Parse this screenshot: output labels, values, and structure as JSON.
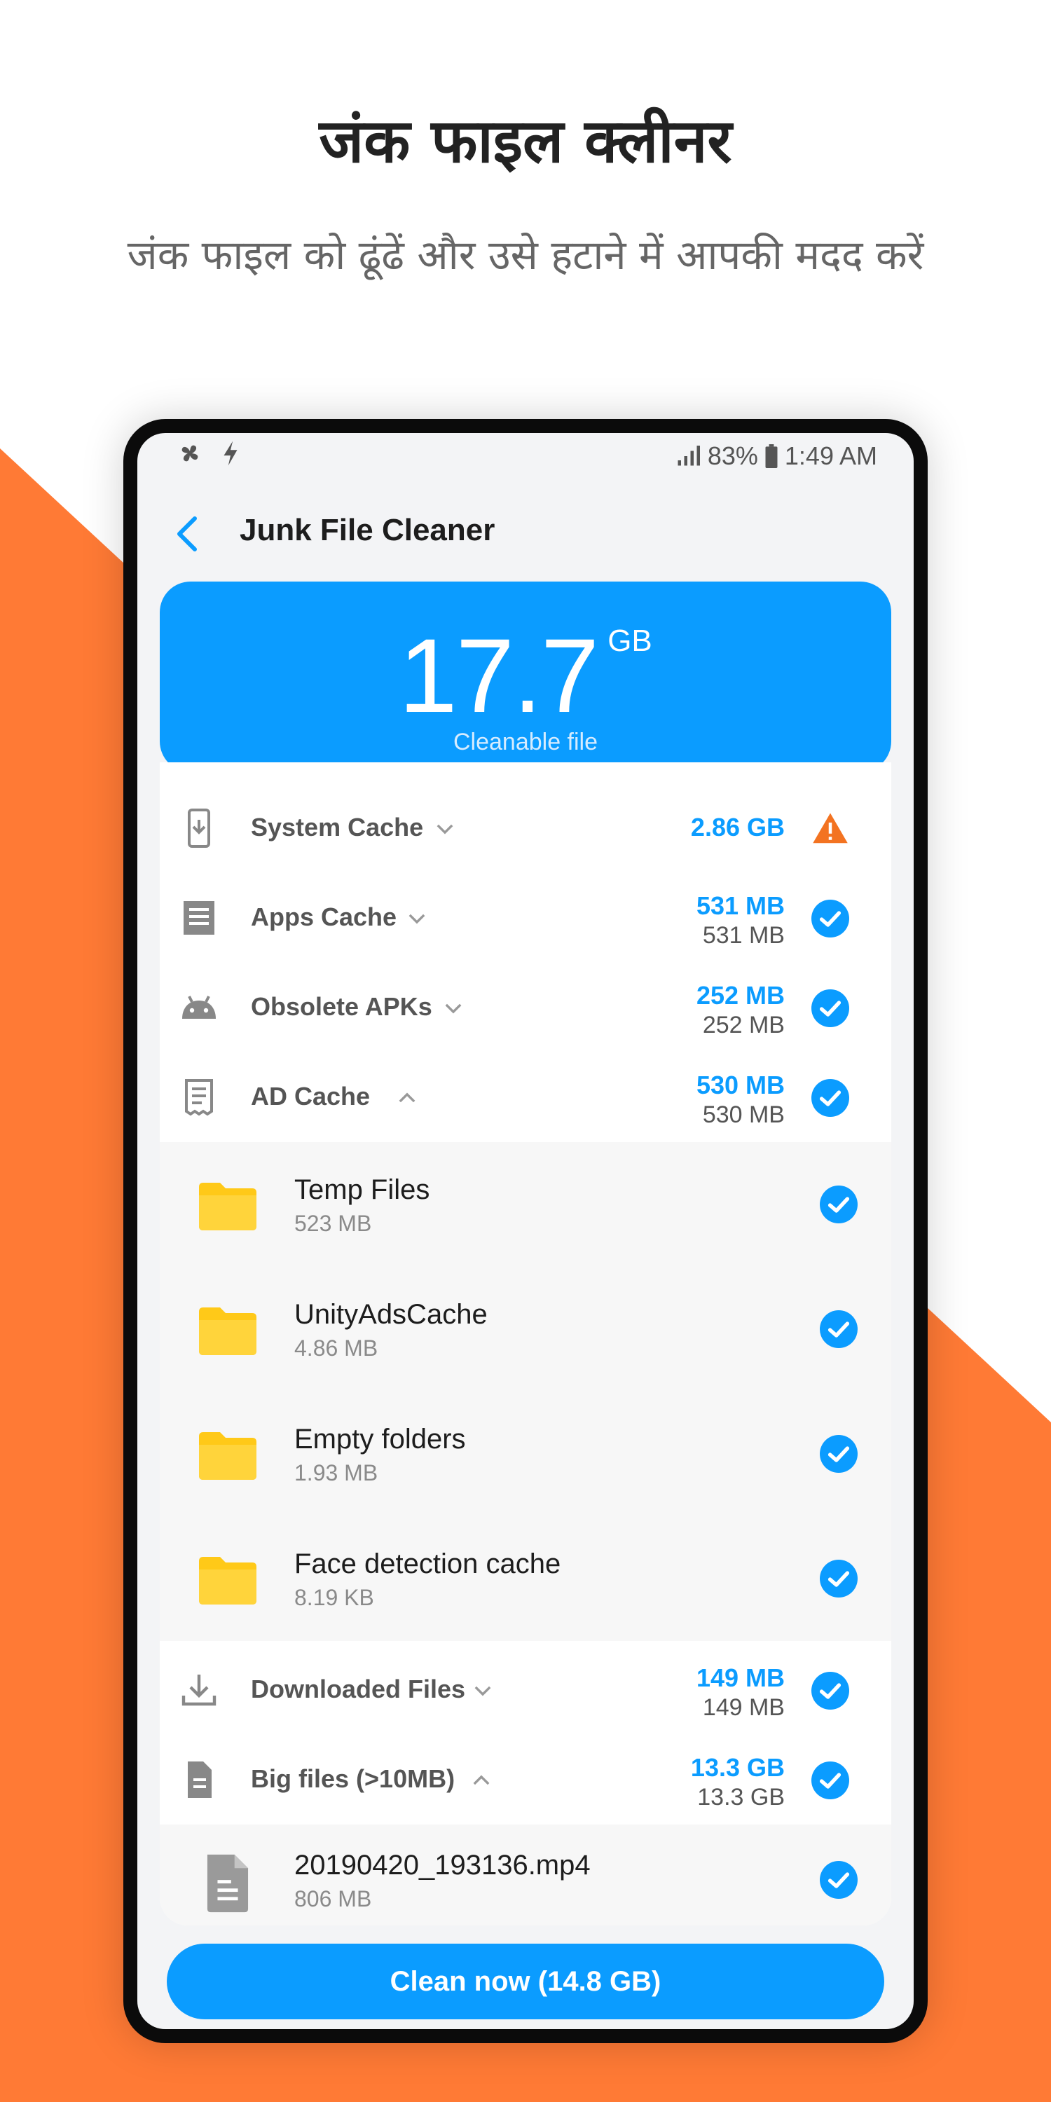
{
  "hero": {
    "title": "जंक फाइल क्लीनर",
    "subtitle": "जंक फाइल को ढूंढें और उसे हटाने में आपकी मदद करें"
  },
  "colors": {
    "accent": "#0b9cff",
    "brand_orange": "#ff7a35",
    "folder": "#ffd43b",
    "warning": "#f37321"
  },
  "status_bar": {
    "signal": "83%",
    "time": "1:49 AM",
    "left_icons": [
      "fan-icon",
      "flash-icon"
    ]
  },
  "app": {
    "title": "Junk File Cleaner",
    "back_icon": "chevron-left-icon"
  },
  "summary": {
    "value": "17.7",
    "unit": "GB",
    "caption": "Cleanable file"
  },
  "categories": [
    {
      "label": "System Cache",
      "size_top": "2.86 GB",
      "size_bot": "",
      "icon": "phone-download-icon",
      "status": "warning",
      "expanded": false
    },
    {
      "label": "Apps Cache",
      "size_top": "531 MB",
      "size_bot": "531 MB",
      "icon": "list-doc-icon",
      "status": "checked",
      "expanded": false
    },
    {
      "label": "Obsolete APKs",
      "size_top": "252 MB",
      "size_bot": "252 MB",
      "icon": "android-icon",
      "status": "checked",
      "expanded": false
    },
    {
      "label": "AD Cache",
      "size_top": "530 MB",
      "size_bot": "530 MB",
      "icon": "receipt-icon",
      "status": "checked",
      "expanded": true
    },
    {
      "label": "Downloaded Files",
      "size_top": "149 MB",
      "size_bot": "149 MB",
      "icon": "download-icon",
      "status": "checked",
      "expanded": false
    },
    {
      "label": "Big files (>10MB)",
      "size_top": "13.3 GB",
      "size_bot": "13.3 GB",
      "icon": "file-icon",
      "status": "checked",
      "expanded": true
    }
  ],
  "ad_cache_items": [
    {
      "name": "Temp Files",
      "size": "523 MB"
    },
    {
      "name": "UnityAdsCache",
      "size": "4.86 MB"
    },
    {
      "name": "Empty folders",
      "size": "1.93 MB"
    },
    {
      "name": "Face detection cache",
      "size": "8.19 KB"
    }
  ],
  "big_files_items": [
    {
      "name": "20190420_193136.mp4",
      "size": "806 MB"
    }
  ],
  "clean_button": {
    "label": "Clean now (14.8 GB)"
  }
}
